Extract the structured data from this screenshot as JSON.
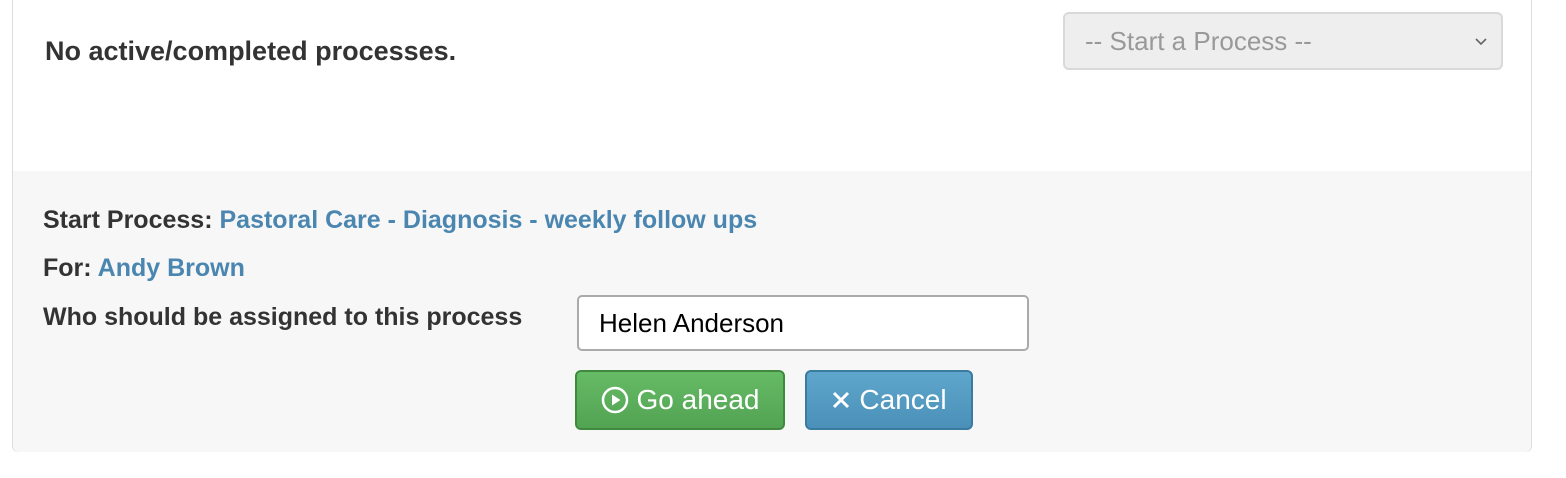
{
  "top": {
    "empty_message": "No active/completed processes.",
    "start_select": {
      "selected": "-- Start a Process --"
    }
  },
  "start_form": {
    "process_label": "Start Process:",
    "process_name": "Pastoral Care - Diagnosis - weekly follow ups",
    "for_label": "For:",
    "for_name": "Andy Brown",
    "assign_label": "Who should be assigned to this process",
    "assign_value": "Helen Anderson",
    "go_label": "Go ahead",
    "cancel_label": "Cancel"
  },
  "colors": {
    "link": "#4a86b0",
    "go_button": "#5cb85c",
    "cancel_button": "#5bc0de"
  },
  "icons": {
    "go": "play-circle-icon",
    "cancel": "close-icon",
    "select": "chevron-down-icon"
  }
}
